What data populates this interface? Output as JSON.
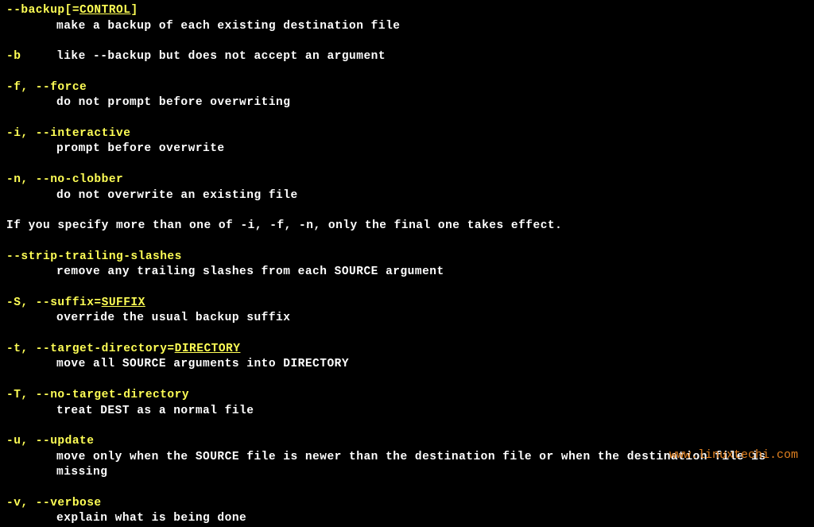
{
  "options": {
    "backup": {
      "flag_prefix": "--backup[=",
      "flag_arg": "CONTROL",
      "flag_suffix": "]",
      "desc": "make a backup of each existing destination file"
    },
    "b": {
      "flag": "-b",
      "desc": "like --backup but does not accept an argument"
    },
    "force": {
      "flag": "-f, --force",
      "desc": "do not prompt before overwriting"
    },
    "interactive": {
      "flag": "-i, --interactive",
      "desc": "prompt before overwrite"
    },
    "noclobber": {
      "flag": "-n, --no-clobber",
      "desc": "do not overwrite an existing file"
    },
    "note": "If you specify more than one of -i, -f, -n, only the final one takes effect.",
    "strip": {
      "flag": "--strip-trailing-slashes",
      "desc": "remove any trailing slashes from each SOURCE argument"
    },
    "suffix": {
      "flag_prefix": "-S, --suffix=",
      "flag_arg": "SUFFIX",
      "desc": "override the usual backup suffix"
    },
    "target": {
      "flag_prefix": "-t, --target-directory=",
      "flag_arg": "DIRECTORY",
      "desc": "move all SOURCE arguments into DIRECTORY"
    },
    "notarget": {
      "flag": "-T, --no-target-directory",
      "desc": "treat DEST as a normal file"
    },
    "update": {
      "flag": "-u, --update",
      "desc": "move only when the SOURCE file is newer than the destination file or when the destination file is missing"
    },
    "verbose": {
      "flag": "-v, --verbose",
      "desc": "explain what is being done"
    }
  },
  "watermark": "www.linuxtechi.com"
}
